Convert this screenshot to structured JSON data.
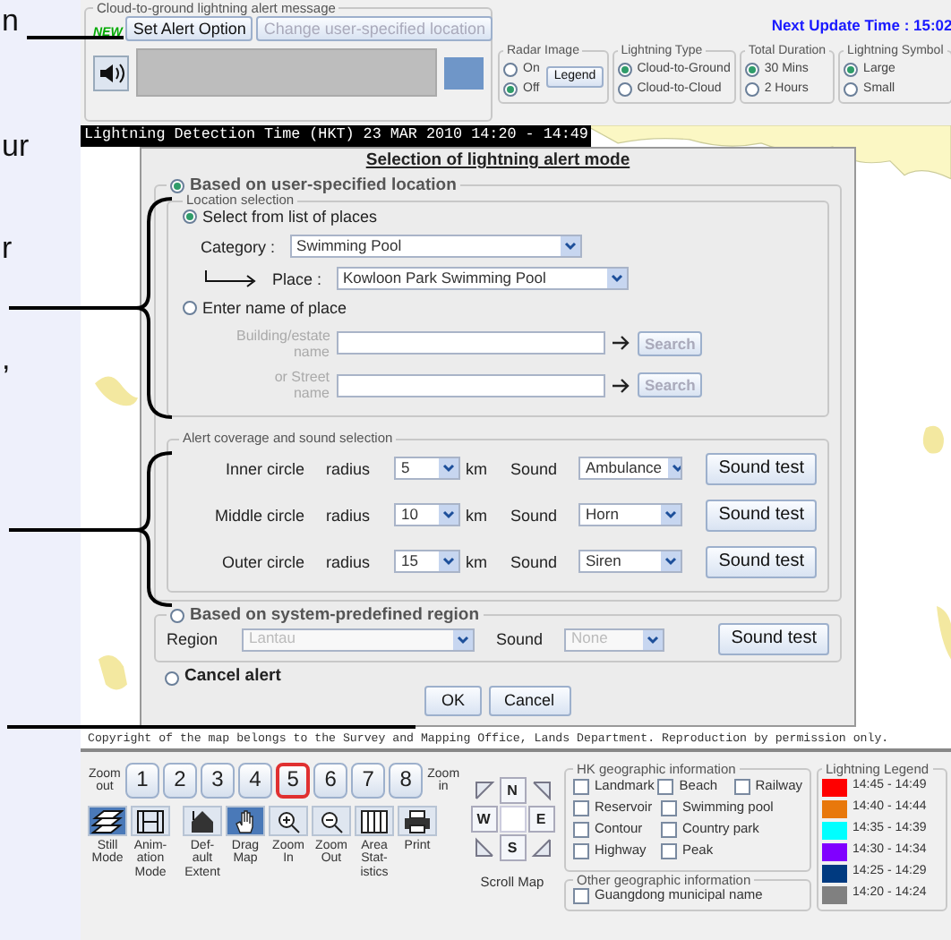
{
  "callout_fragments": [
    "n",
    "ur",
    "r",
    ","
  ],
  "alert_message": {
    "title": "Cloud-to-ground lightning alert message",
    "new_label": "NEW",
    "buttons": [
      {
        "label": "Set Alert Option",
        "disabled": false
      },
      {
        "label": "Change user-specified location",
        "disabled": true
      }
    ]
  },
  "next_update": "Next Update Time : 15:02",
  "option_groups": [
    {
      "title": "Radar Image",
      "options": [
        {
          "label": "On",
          "selected": false
        },
        {
          "label": "Off",
          "selected": true
        }
      ],
      "button": "Legend"
    },
    {
      "title": "Lightning Type",
      "options": [
        {
          "label": "Cloud-to-Ground",
          "selected": true
        },
        {
          "label": "Cloud-to-Cloud",
          "selected": false
        }
      ]
    },
    {
      "title": "Total Duration",
      "options": [
        {
          "label": "30 Mins",
          "selected": true
        },
        {
          "label": "2 Hours",
          "selected": false
        }
      ]
    },
    {
      "title": "Lightning Symbol",
      "options": [
        {
          "label": "Large",
          "selected": true
        },
        {
          "label": "Small",
          "selected": false
        }
      ]
    }
  ],
  "detection_time": "Lightning Detection Time (HKT) 23 MAR 2010 14:20 - 14:49",
  "dialog": {
    "title": "Selection of lightning alert mode",
    "user_location": {
      "label": "Based on user-specified location",
      "selected": true
    },
    "location_selection": {
      "title": "Location selection",
      "list_option": {
        "label": "Select from list of places",
        "selected": true
      },
      "category_label": "Category :",
      "category": "Swimming Pool",
      "place_label": "Place :",
      "place": "Kowloon Park Swimming Pool",
      "name_option": {
        "label": "Enter name of place",
        "selected": false
      },
      "name_fields": {
        "disabled": true,
        "building_label": "Building/estate name",
        "street_label": "or Street name",
        "search_buttons": [
          "Search",
          "Search"
        ]
      }
    },
    "coverage": {
      "title": "Alert coverage and sound selection",
      "rows": [
        {
          "circle": "Inner circle",
          "radius_label": "radius",
          "radius": "5",
          "unit": "km",
          "sound_label": "Sound",
          "sound": "Ambulance",
          "button": "Sound test"
        },
        {
          "circle": "Middle circle",
          "radius_label": "radius",
          "radius": "10",
          "unit": "km",
          "sound_label": "Sound",
          "sound": "Horn",
          "button": "Sound test"
        },
        {
          "circle": "Outer circle",
          "radius_label": "radius",
          "radius": "15",
          "unit": "km",
          "sound_label": "Sound",
          "sound": "Siren",
          "button": "Sound test"
        }
      ]
    },
    "predefined": {
      "label": "Based on system-predefined region",
      "selected": false,
      "disabled": true,
      "region_label": "Region",
      "region": "Lantau",
      "sound_label": "Sound",
      "sound": "None",
      "button": "Sound test"
    },
    "cancel_option": {
      "label": "Cancel alert",
      "selected": false
    },
    "buttons": [
      "OK",
      "Cancel"
    ]
  },
  "copyright": "Copyright of the map belongs to the Survey and Mapping Office, Lands Department. Reproduction by permission only.",
  "zoom": {
    "out_label": "Zoom out",
    "in_label": "Zoom in",
    "levels": [
      {
        "label": "1",
        "selected": false
      },
      {
        "label": "2",
        "selected": false
      },
      {
        "label": "3",
        "selected": false
      },
      {
        "label": "4",
        "selected": false
      },
      {
        "label": "5",
        "selected": true
      },
      {
        "label": "6",
        "selected": false
      },
      {
        "label": "7",
        "selected": false
      },
      {
        "label": "8",
        "selected": false
      }
    ]
  },
  "tools": [
    {
      "label": "Still Mode",
      "selected": true
    },
    {
      "label": "Anim-ation Mode",
      "selected": false
    },
    {
      "label": "Def-ault Extent",
      "selected": false
    },
    {
      "label": "Drag Map",
      "selected": true
    },
    {
      "label": "Zoom In",
      "selected": false
    },
    {
      "label": "Zoom Out",
      "selected": false
    },
    {
      "label": "Area Stat-istics",
      "selected": false
    },
    {
      "label": "Print",
      "selected": false
    }
  ],
  "compass": {
    "directions": [
      "N",
      "W",
      "E",
      "S"
    ],
    "caption": "Scroll Map"
  },
  "hk_geo": {
    "title": "HK geographic information",
    "rows": [
      [
        {
          "label": "Landmark",
          "checked": false
        },
        {
          "label": "Beach",
          "checked": false
        },
        {
          "label": "Railway",
          "checked": false
        }
      ],
      [
        {
          "label": "Reservoir",
          "checked": false
        },
        {
          "label": "Swimming pool",
          "checked": false
        }
      ],
      [
        {
          "label": "Contour",
          "checked": false
        },
        {
          "label": "Country park",
          "checked": false
        }
      ],
      [
        {
          "label": "Highway",
          "checked": false
        },
        {
          "label": "Peak",
          "checked": false
        }
      ]
    ]
  },
  "other_geo": {
    "title": "Other geographic information",
    "items": [
      {
        "label": "Guangdong municipal name",
        "checked": false
      }
    ]
  },
  "legend": {
    "title": "Lightning Legend",
    "items": [
      {
        "label": "14:45 - 14:49",
        "color": "#ff0000"
      },
      {
        "label": "14:40 - 14:44",
        "color": "#e8780c"
      },
      {
        "label": "14:35 - 14:39",
        "color": "#00ffff"
      },
      {
        "label": "14:30 - 14:34",
        "color": "#8000ff"
      },
      {
        "label": "14:25 - 14:29",
        "color": "#003a80"
      },
      {
        "label": "14:20 - 14:24",
        "color": "#808080"
      }
    ]
  }
}
